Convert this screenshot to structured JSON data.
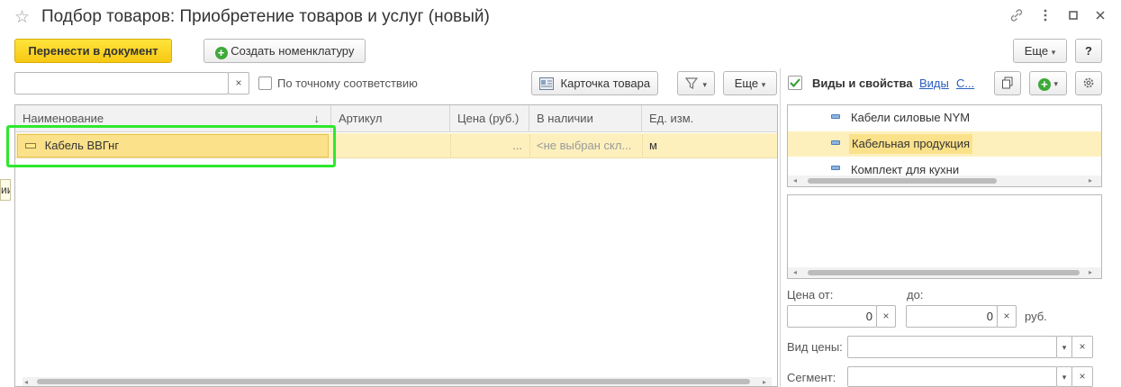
{
  "window": {
    "title": "Подбор товаров: Приобретение товаров и услуг (новый)",
    "controls": [
      "link-icon",
      "more-icon",
      "maximize-icon",
      "close-icon"
    ]
  },
  "toolbar": {
    "transfer_label": "Перенести в документ",
    "create_label": "Создать номенклатуру",
    "more_label": "Еще",
    "help_label": "?"
  },
  "search": {
    "value": "",
    "clear": "×",
    "exact_match_label": "По точному соответствию",
    "exact_match_checked": false,
    "card_label": "Карточка товара",
    "more_label": "Еще"
  },
  "table": {
    "columns": [
      "Наименование",
      "Артикул",
      "Цена (руб.)",
      "В наличии",
      "Ед. изм."
    ],
    "sort_indicator": "↓",
    "rows": [
      {
        "name": "Кабель ВВГнг",
        "article": "",
        "price": "...",
        "stock": "<не выбран скл...",
        "unit": "м",
        "selected": true
      }
    ]
  },
  "side_tooltip": "ии",
  "right_panel": {
    "props_checked": true,
    "props_label": "Виды и свойства",
    "link_types": "Виды",
    "link_c": "С...",
    "tree_items": [
      {
        "label": "Кабели силовые NYM",
        "selected": false
      },
      {
        "label": "Кабельная продукция",
        "selected": true
      },
      {
        "label": "Комплект для кухни",
        "selected": false
      }
    ],
    "price_from_label": "Цена от:",
    "price_to_label": "до:",
    "price_from_value": "0",
    "price_to_value": "0",
    "currency": "руб.",
    "price_type_label": "Вид цены:",
    "price_type_value": "",
    "segment_label": "Сегмент:",
    "segment_value": ""
  },
  "colors": {
    "accent_yellow": "#f7c814",
    "selected_row": "#fdf0bd",
    "highlight_frame": "#2ee82e"
  }
}
